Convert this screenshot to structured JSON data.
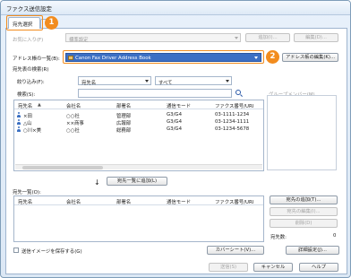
{
  "window": {
    "title": "ファクス送信設定"
  },
  "tabs": [
    {
      "label": "宛先選択",
      "badge": "1"
    },
    {
      "label": ""
    }
  ],
  "favorites": {
    "label": "お気に入り(F)",
    "value": "標準設定",
    "add_button": "追加(I)...",
    "edit_button": "編集(D)..."
  },
  "address_book": {
    "label": "アドレス帳の一覧(B):",
    "value": "Canon Fax Driver Address Book",
    "badge": "2",
    "edit_button": "アドレス帳の編集(K)..."
  },
  "search_section": {
    "label": "宛先表の検索(R)"
  },
  "filter": {
    "label": "絞り込み(F):",
    "field_value": "宛先名",
    "scope_value": "すべて"
  },
  "search": {
    "label": "検索(S):",
    "value": ""
  },
  "group_member": {
    "label": "グループメンバー(M)"
  },
  "address_table": {
    "columns": [
      "宛先名",
      "会社名",
      "部署名",
      "通信モード",
      "ファクス番号/URI"
    ],
    "rows": [
      [
        "×田",
        "○○社",
        "管理部",
        "G3/G4",
        "03-1111-1234"
      ],
      [
        "△山",
        "××商事",
        "広報部",
        "G3/G4",
        "03-1234-1111"
      ],
      [
        "○川×美",
        "○○社",
        "総務部",
        "G3/G4",
        "03-1234-5678"
      ]
    ]
  },
  "add_to_list_button": "宛先一覧に追加(L)",
  "destination_list": {
    "label": "宛先一覧(O):",
    "columns": [
      "宛先名",
      "会社名",
      "部署名",
      "通信モード",
      "ファクス番号/URI"
    ]
  },
  "side_buttons": {
    "add_destination": "宛先の追加(T)...",
    "edit_destination": "宛先の編集(I)...",
    "delete": "削除(D)",
    "count_label": "宛先数:",
    "count_value": "0"
  },
  "save_image": {
    "label": "送信イメージを保存する(G)",
    "checked": false
  },
  "cover_sheet_button": "カバーシート(V)...",
  "detail_settings_button": "詳細設定(J)...",
  "footer": {
    "send": "送信(S)",
    "cancel": "キャンセル",
    "help": "ヘルプ"
  },
  "colors": {
    "accent": "#f28c1e",
    "selection": "#3c6fc4"
  }
}
